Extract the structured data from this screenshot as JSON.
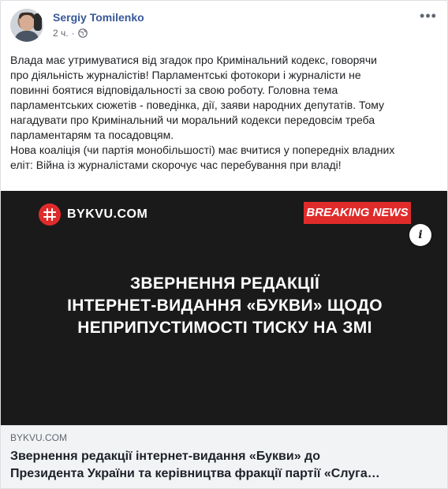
{
  "post": {
    "author": "Sergiy Tomilenko",
    "time": "2 ч.",
    "separator": "·",
    "more_glyph": "•••",
    "text_lines": [
      "Влада має утримуватися від згадок про Кримінальний кодекс, говорячи",
      "про діяльність журналістів! Парламентські фотокори і журналісти не",
      "повинні боятися відповідальності за свою роботу. Головна тема",
      "парламентських сюжетів - поведінка, дії, заяви народних депутатів. Тому",
      "нагадувати про Кримінальний чи моральний кодекси передовсім треба",
      "парламентарям та посадовцям.",
      "Нова коаліція (чи партія монобільшості) має вчитися у попередніх владних",
      "еліт: Війна із журналістами скорочує час перебування при владі!"
    ]
  },
  "media": {
    "brand_name": "BYKVU.COM",
    "badge": "BREAKING NEWS",
    "headline_lines": [
      "ЗВЕРНЕННЯ РЕДАКЦІЇ",
      "ІНТЕРНЕТ-ВИДАННЯ «БУКВИ» ЩОДО",
      "НЕПРИПУСТИМОСТІ ТИСКУ НА ЗМІ"
    ],
    "info_glyph": "i"
  },
  "link": {
    "domain": "BYKVU.COM",
    "title_lines": [
      "Звернення редакції інтернет-видання «Букви» до",
      "Президента України та керівництва фракції партії «Слуга…"
    ]
  },
  "colors": {
    "author": "#385898",
    "brand_red": "#e02b2b",
    "media_bg": "#1a1a1a"
  },
  "icons": [
    "globe-icon",
    "more-options-icon",
    "info-icon",
    "bykvu-logo-icon"
  ]
}
